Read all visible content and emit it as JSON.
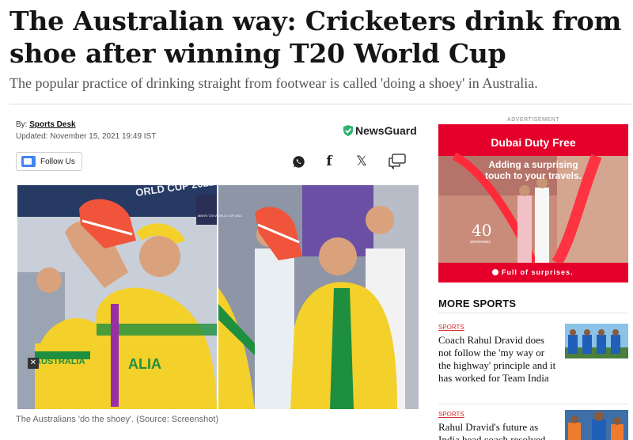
{
  "article": {
    "headline": "The Australian way: Cricketers drink from shoe after winning T20 World Cup",
    "subheadline": "The popular practice of drinking straight from footwear is called 'doing a shoey' in Australia.",
    "byline_prefix": "By:",
    "author": "Sports Desk",
    "updated": "Updated: November 15, 2021 19:49 IST",
    "newsguard_label": "NewsGuard",
    "follow_label": "Follow Us",
    "photo_caption": "The Australians 'do the shoey'. (Source: Screenshot)",
    "photo_text": [
      "ORLD CUP 2021",
      "MEN'S T20 WORLD CUP 2021",
      "AUSTRALIA",
      "ALIA"
    ]
  },
  "share": {
    "icons": [
      "whatsapp-icon",
      "facebook-icon",
      "x-icon",
      "comment-icon"
    ],
    "facebook_glyph": "f",
    "x_glyph": "𝕏"
  },
  "ad": {
    "label": "ADVERTISEMENT",
    "brand": "Dubai Duty Free",
    "tagline_1": "Adding a surprising",
    "tagline_2": "touch to your travels.",
    "anniversary_number": "40",
    "anniversary_text": "anniversary",
    "footer": "Full of surprises."
  },
  "sidebar": {
    "title": "MORE SPORTS",
    "stories": [
      {
        "tag": "SPORTS",
        "title": "Coach Rahul Dravid does not follow the 'my way or the highway' principle and it has worked for Team India"
      },
      {
        "tag": "SPORTS",
        "title": "Rahul Dravid's future as India head coach resolved"
      }
    ]
  },
  "colors": {
    "ad_red": "#e4002b",
    "sports_tag": "#d0302b",
    "newsguard_green": "#2fb46e",
    "australia_yellow": "#f4d02a",
    "australia_green": "#1e8f3e"
  }
}
